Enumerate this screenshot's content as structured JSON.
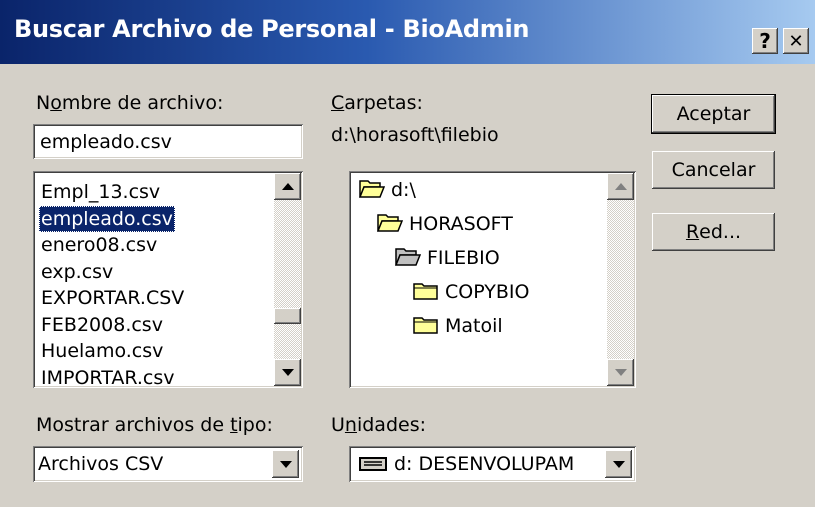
{
  "window": {
    "title": "Buscar Archivo de Personal - BioAdmin",
    "help_button": "?",
    "close_button": "✕"
  },
  "filename": {
    "label_prefix": "N",
    "label_accel": "o",
    "label_rest": "mbre de archivo:",
    "value": "empleado.csv"
  },
  "file_list": {
    "items": [
      {
        "name": "Empl_13.csv",
        "selected": false
      },
      {
        "name": "empleado.csv",
        "selected": true
      },
      {
        "name": "enero08.csv",
        "selected": false
      },
      {
        "name": "exp.csv",
        "selected": false
      },
      {
        "name": "EXPORTAR.CSV",
        "selected": false
      },
      {
        "name": "FEB2008.csv",
        "selected": false
      },
      {
        "name": "Huelamo.csv",
        "selected": false
      },
      {
        "name": "IMPORTAR.csv",
        "selected": false
      }
    ]
  },
  "folders": {
    "label_accel": "C",
    "label_rest": "arpetas:",
    "current_path": "d:\\horasoft\\filebio",
    "items": [
      {
        "name": "d:\\",
        "state": "open"
      },
      {
        "name": "HORASOFT",
        "state": "open"
      },
      {
        "name": "FILEBIO",
        "state": "open-current"
      },
      {
        "name": "COPYBIO",
        "state": "closed"
      },
      {
        "name": "Matoil",
        "state": "closed"
      }
    ]
  },
  "file_type": {
    "label_prefix": "Mostrar archivos de ",
    "label_accel": "t",
    "label_rest": "ipo:",
    "value": "Archivos CSV"
  },
  "drives": {
    "label_prefix": "U",
    "label_accel": "n",
    "label_rest": "idades:",
    "value": "d: DESENVOLUPAM",
    "icon": "drive-icon"
  },
  "buttons": {
    "accept": "Aceptar",
    "cancel": "Cancelar",
    "network_accel": "R",
    "network_rest": "ed..."
  },
  "colors": {
    "selection": "#0a246a",
    "face": "#d4d0c8"
  }
}
